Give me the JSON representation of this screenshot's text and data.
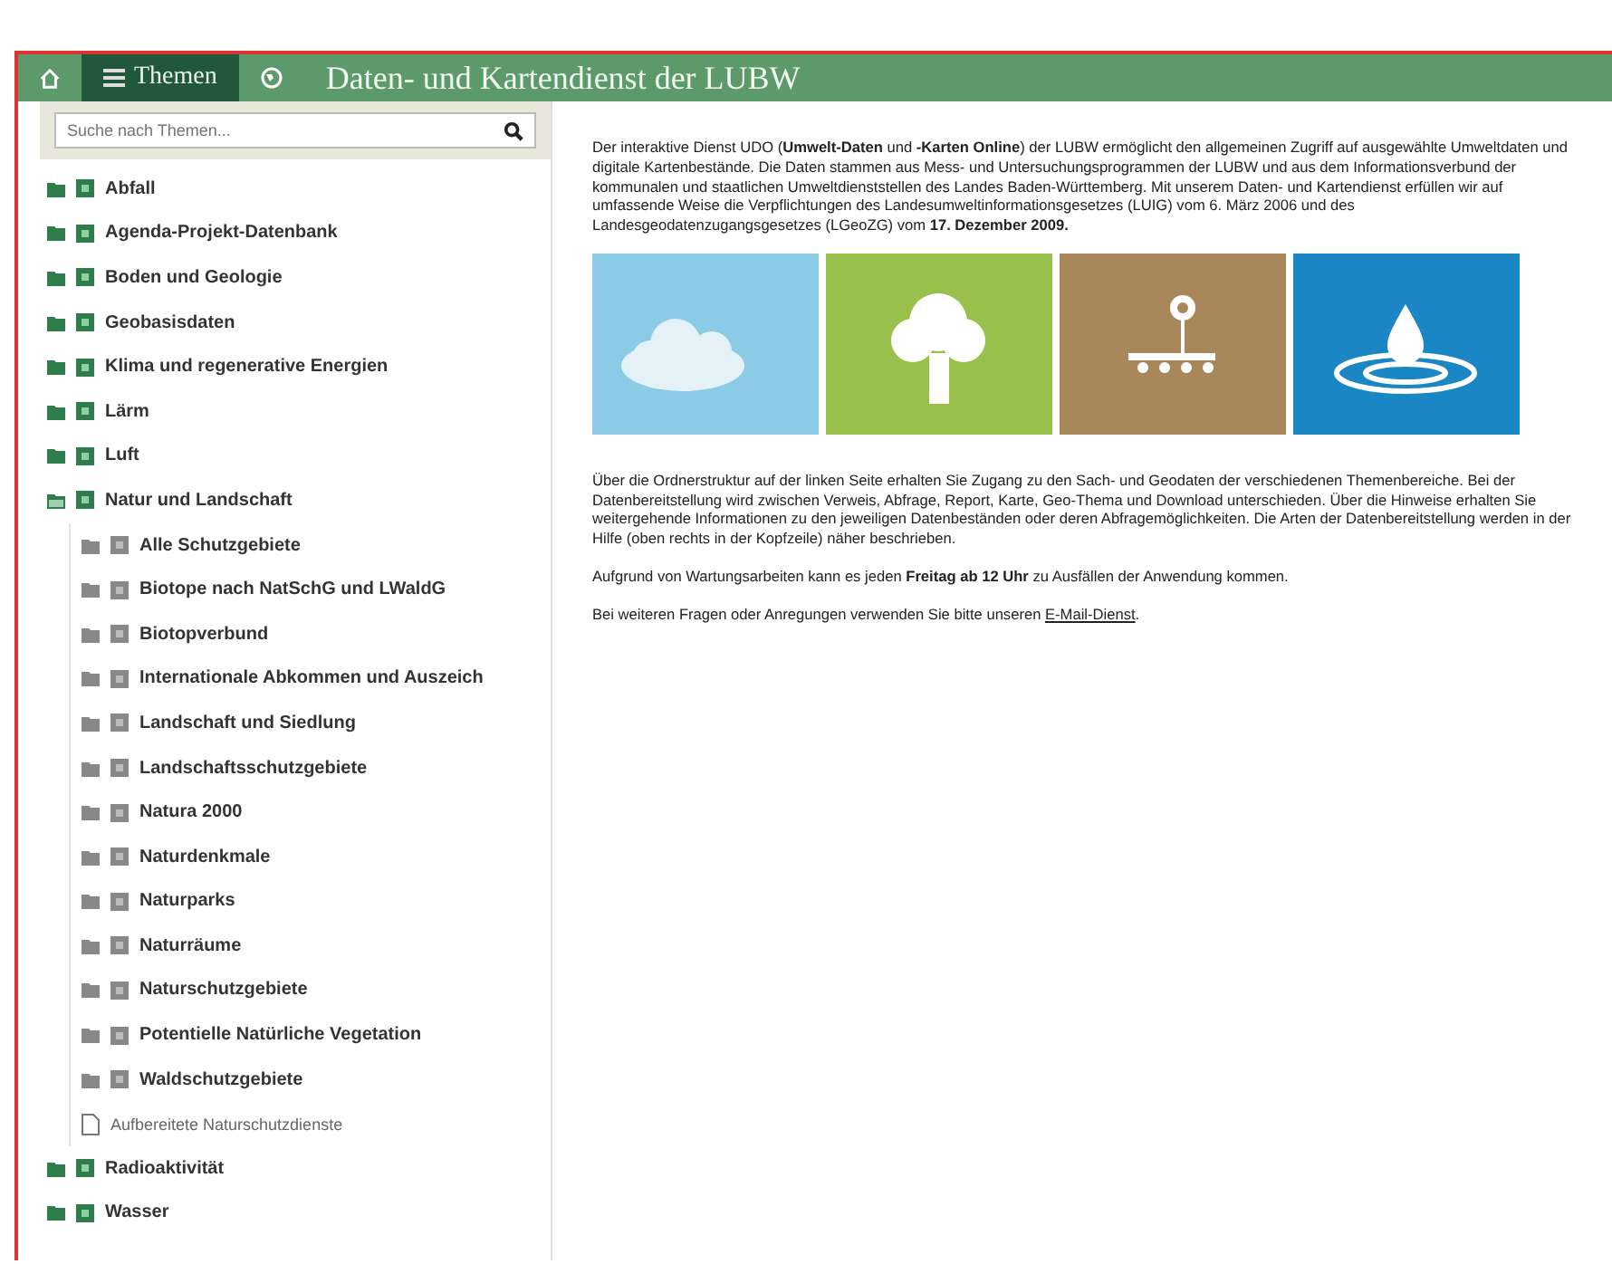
{
  "header": {
    "tabs": [
      {
        "kind": "home",
        "selected": false
      },
      {
        "kind": "topics",
        "label": "Themen",
        "selected": true
      },
      {
        "kind": "globe",
        "selected": false
      }
    ],
    "title": "Daten- und Kartendienst der LUBW"
  },
  "sidebar": {
    "search": {
      "placeholder": "Suche nach Themen..."
    },
    "tree": [
      {
        "label": "Abfall",
        "kind": "folder",
        "expanded": false
      },
      {
        "label": "Agenda-Projekt-Datenbank",
        "kind": "folder",
        "expanded": false
      },
      {
        "label": "Boden und Geologie",
        "kind": "folder",
        "expanded": false
      },
      {
        "label": "Geobasisdaten",
        "kind": "folder",
        "expanded": false
      },
      {
        "label": "Klima und regenerative Energien",
        "kind": "folder",
        "expanded": false
      },
      {
        "label": "Lärm",
        "kind": "folder",
        "expanded": false
      },
      {
        "label": "Luft",
        "kind": "folder",
        "expanded": false
      },
      {
        "label": "Natur und Landschaft",
        "kind": "folder",
        "expanded": true,
        "children": [
          {
            "label": "Alle Schutzgebiete",
            "kind": "folder",
            "expanded": false
          },
          {
            "label": "Biotope nach NatSchG und LWaldG",
            "kind": "folder",
            "expanded": false
          },
          {
            "label": "Biotopverbund",
            "kind": "folder",
            "expanded": false
          },
          {
            "label": "Internationale Abkommen und Auszeich",
            "kind": "folder",
            "expanded": false
          },
          {
            "label": "Landschaft und Siedlung",
            "kind": "folder",
            "expanded": false
          },
          {
            "label": "Landschaftsschutzgebiete",
            "kind": "folder",
            "expanded": false
          },
          {
            "label": "Natura 2000",
            "kind": "folder",
            "expanded": false
          },
          {
            "label": "Naturdenkmale",
            "kind": "folder",
            "expanded": false
          },
          {
            "label": "Naturparks",
            "kind": "folder",
            "expanded": false
          },
          {
            "label": "Naturräume",
            "kind": "folder",
            "expanded": false
          },
          {
            "label": "Naturschutzgebiete",
            "kind": "folder",
            "expanded": false
          },
          {
            "label": "Potentielle Natürliche Vegetation",
            "kind": "folder",
            "expanded": false
          },
          {
            "label": "Waldschutzgebiete",
            "kind": "folder",
            "expanded": false
          },
          {
            "label": "Aufbereitete Naturschutzdienste",
            "kind": "document"
          }
        ]
      },
      {
        "label": "Radioaktivität",
        "kind": "folder",
        "expanded": false
      },
      {
        "label": "Wasser",
        "kind": "folder",
        "expanded": false
      }
    ]
  },
  "content": {
    "intro": "Der interaktive Dienst UDO (**Umwelt-Daten** und **-Karten Online**) der LUBW ermöglicht den allgemeinen Zugriff auf ausgewählte Umweltdaten und digitale Kartenbestände. Die Daten stammen aus Mess- und Untersuchungsprogrammen der LUBW und aus dem Informationsverbund der kommunalen und staatlichen Umweltdienststellen des Landes Baden-Württemberg. Mit unserem Daten- und Kartendienst erfüllen wir auf umfassende Weise die Verpflichtungen des Landesumweltinformationsgesetzes (LUIG) vom 6. März 2006 und des Landesgeodatenzugangsgesetzes (LGeoZG) vom **17. Dezember 2009.**",
    "tiles": [
      {
        "kind": "cloud",
        "color": "#8ccbe6"
      },
      {
        "kind": "tree",
        "color": "#99c04a"
      },
      {
        "kind": "flower",
        "color": "#a8885a"
      },
      {
        "kind": "water",
        "color": "#1b86c4"
      }
    ],
    "paragraphs": [
      "Über die Ordnerstruktur auf der linken Seite erhalten Sie Zugang zu den Sach- und Geodaten der verschiedenen Themenbereiche. Bei der Datenbereitstellung wird zwischen Verweis, Abfrage, Report, Karte, Geo-Thema und Download unterschieden. Über die Hinweise erhalten Sie weitergehende Informationen zu den jeweiligen Datenbeständen oder deren Abfragemöglichkeiten. Die Arten der Datenbereitstellung werden in der Hilfe (oben rechts in der Kopfzeile) näher beschrieben.",
      "Aufgrund von Wartungsarbeiten kann es jeden **Freitag ab 12 Uhr** zu Ausfällen der Anwendung kommen."
    ],
    "contact": {
      "text": "Bei weiteren Fragen oder Anregungen verwenden Sie bitte unseren",
      "link": "E-Mail-Dienst",
      "end": "."
    }
  }
}
